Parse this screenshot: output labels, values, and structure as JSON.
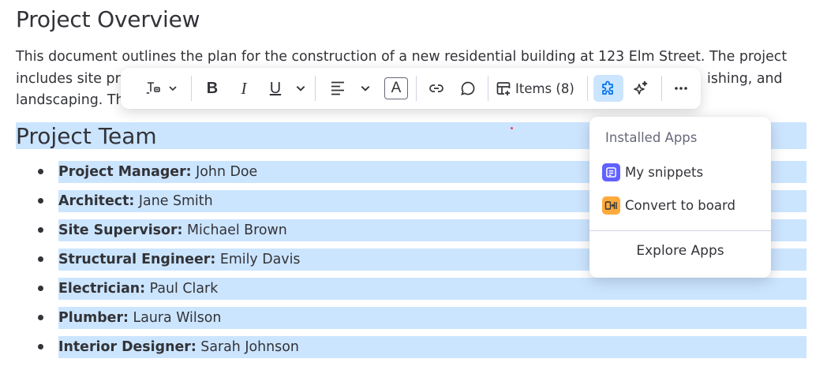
{
  "document": {
    "title": "Project Overview",
    "paragraph": {
      "line1": "This document outlines the plan for the construction of a new residential building at 123 Elm Street. The project",
      "line2_start": "includes site pr",
      "line2_end": "ishing, and",
      "line3": "landscaping. Th"
    },
    "team_heading": "Project Team",
    "team": [
      {
        "role": "Project Manager:",
        "name": " John Doe"
      },
      {
        "role": "Architect:",
        "name": " Jane Smith"
      },
      {
        "role": "Site Supervisor:",
        "name": " Michael Brown"
      },
      {
        "role": "Structural Engineer:",
        "name": " Emily Davis"
      },
      {
        "role": "Electrician:",
        "name": " Paul Clark"
      },
      {
        "role": "Plumber:",
        "name": " Laura Wilson"
      },
      {
        "role": "Interior Designer:",
        "name": " Sarah Johnson"
      }
    ]
  },
  "toolbar": {
    "items_label": "Items (8)",
    "icons": [
      "text-style-icon",
      "chevron-down-icon",
      "bold-icon",
      "italic-icon",
      "underline-icon",
      "chevron-down-icon",
      "align-left-icon",
      "chevron-down-icon",
      "text-color-icon",
      "link-icon",
      "comment-icon",
      "add-items-icon",
      "apps-puzzle-icon",
      "ai-sparkle-icon",
      "more-icon"
    ],
    "format_letters": {
      "bold": "B",
      "italic": "I",
      "underline": "U",
      "text_color": "A"
    },
    "colors": {
      "active_bg": "#cce5ff",
      "accent": "#0073ea"
    }
  },
  "apps_menu": {
    "header": "Installed Apps",
    "items": [
      {
        "label": "My snippets",
        "icon": "snippets-app-icon",
        "icon_color": "#6161ff"
      },
      {
        "label": "Convert to board",
        "icon": "convert-to-board-app-icon",
        "icon_color": "#fdab3d"
      }
    ],
    "explore_label": "Explore Apps"
  },
  "colors": {
    "selection_highlight": "#cce5ff",
    "text": "#323338"
  }
}
